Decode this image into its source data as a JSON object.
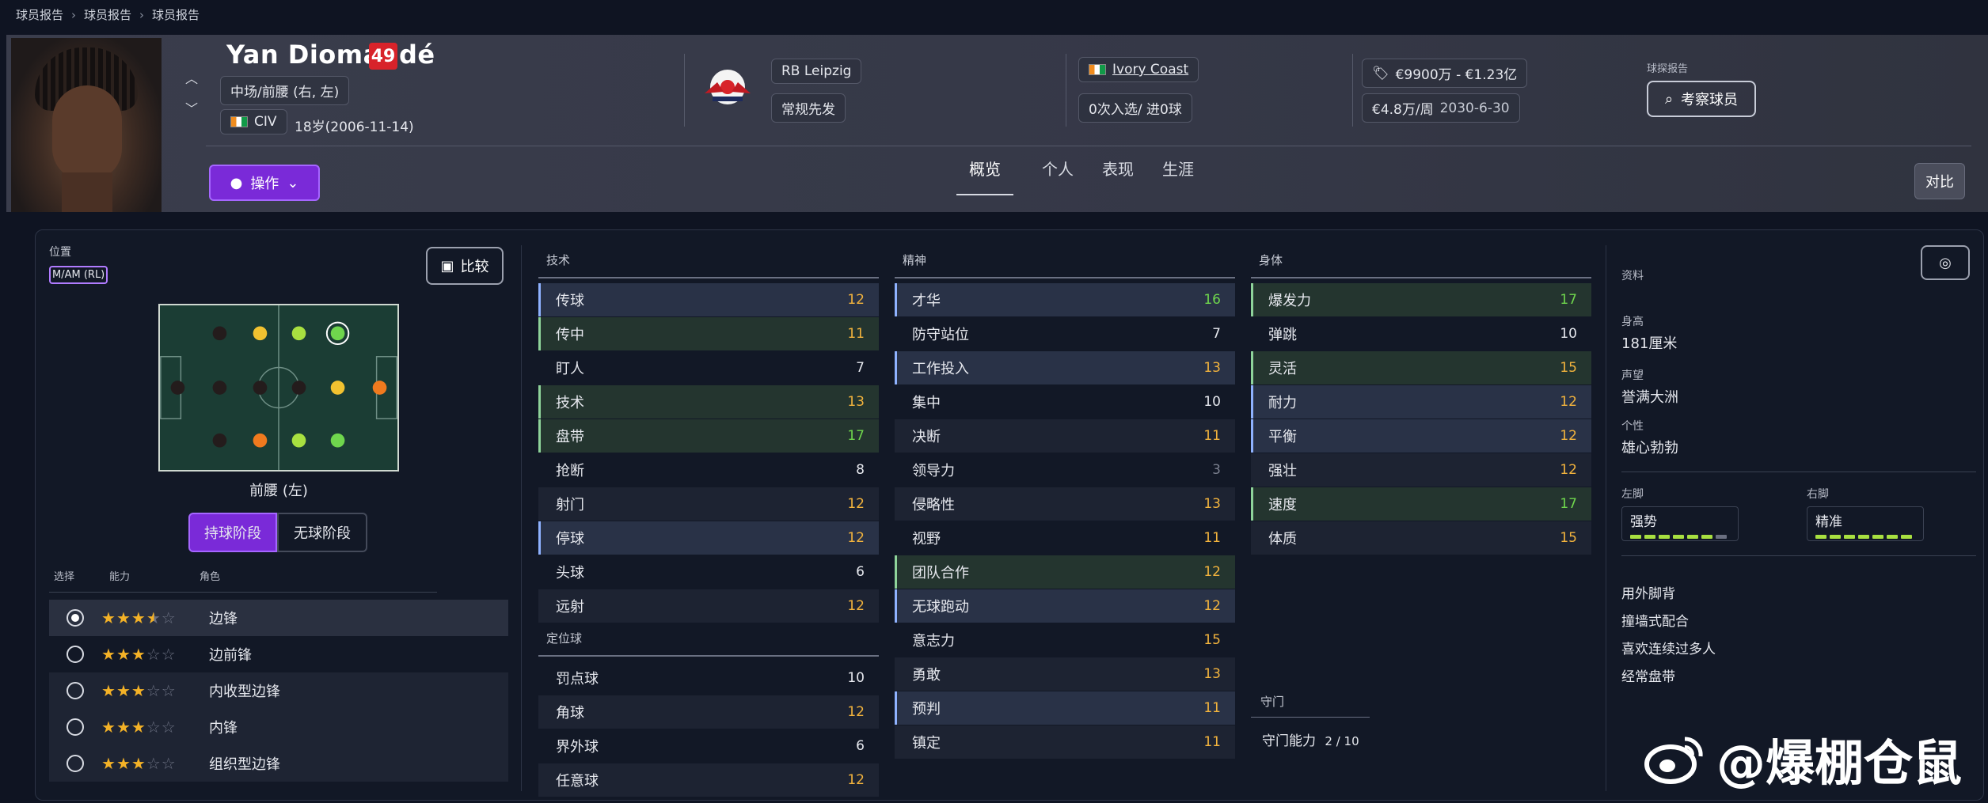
{
  "breadcrumb": [
    "球员报告",
    "球员报告",
    "球员报告"
  ],
  "header": {
    "name": "Yan Diomandé",
    "ca": "49",
    "position": "中场/前腰 (右, 左)",
    "nation_code": "CIV",
    "age_dob": "18岁(2006-11-14)",
    "club": "RB Leipzig",
    "squad_status": "常规先发",
    "nationality": "Ivory Coast",
    "caps": "0次入选/ 进0球",
    "value": "€9900万 - €1.23亿",
    "wage": "€4.8万/周",
    "contract": "2030-6-30",
    "scout_label": "球探报告",
    "scout_button": "考察球员",
    "actions_button": "操作",
    "compare_button": "对比",
    "tabs": [
      "概览",
      "个人",
      "表现",
      "生涯"
    ],
    "active_tab": "概览"
  },
  "position_panel": {
    "label": "位置",
    "tag": "M/AM (RL)",
    "compare_button": "比较",
    "pitch_caption": "前腰 (左)",
    "phases": [
      "持球阶段",
      "无球阶段"
    ],
    "active_phase": "持球阶段",
    "role_headers": [
      "选择",
      "能力",
      "角色"
    ],
    "roles": [
      {
        "name": "边锋",
        "stars": 3.5,
        "selected": true
      },
      {
        "name": "边前锋",
        "stars": 3,
        "selected": false
      },
      {
        "name": "内收型边锋",
        "stars": 3,
        "selected": false
      },
      {
        "name": "内锋",
        "stars": 3,
        "selected": false
      },
      {
        "name": "组织型边锋",
        "stars": 3,
        "selected": false
      }
    ],
    "pitch_colors": {
      "good": "#6fd64d",
      "ok": "#a8e040",
      "fair": "#f2c230",
      "weak": "#f07a1e",
      "none": "#241c1c"
    }
  },
  "technical": {
    "title": "技术",
    "attrs": [
      {
        "name": "传球",
        "value": "12",
        "color": "yellow",
        "hl": "b"
      },
      {
        "name": "传中",
        "value": "11",
        "color": "yellow",
        "hl": "g"
      },
      {
        "name": "盯人",
        "value": "7",
        "color": "white",
        "hl": ""
      },
      {
        "name": "技术",
        "value": "13",
        "color": "yellow",
        "hl": "g"
      },
      {
        "name": "盘带",
        "value": "17",
        "color": "green",
        "hl": "g"
      },
      {
        "name": "抢断",
        "value": "8",
        "color": "white",
        "hl": ""
      },
      {
        "name": "射门",
        "value": "12",
        "color": "yellow",
        "hl": "shade"
      },
      {
        "name": "停球",
        "value": "12",
        "color": "yellow",
        "hl": "b"
      },
      {
        "name": "头球",
        "value": "6",
        "color": "white",
        "hl": ""
      },
      {
        "name": "远射",
        "value": "12",
        "color": "yellow",
        "hl": "shade"
      }
    ]
  },
  "set_pieces": {
    "title": "定位球",
    "attrs": [
      {
        "name": "罚点球",
        "value": "10",
        "color": "white",
        "hl": ""
      },
      {
        "name": "角球",
        "value": "12",
        "color": "yellow",
        "hl": "shade"
      },
      {
        "name": "界外球",
        "value": "6",
        "color": "white",
        "hl": ""
      },
      {
        "name": "任意球",
        "value": "12",
        "color": "yellow",
        "hl": "shade"
      }
    ]
  },
  "mental": {
    "title": "精神",
    "attrs": [
      {
        "name": "才华",
        "value": "16",
        "color": "green",
        "hl": "b"
      },
      {
        "name": "防守站位",
        "value": "7",
        "color": "white",
        "hl": ""
      },
      {
        "name": "工作投入",
        "value": "13",
        "color": "yellow",
        "hl": "b"
      },
      {
        "name": "集中",
        "value": "10",
        "color": "white",
        "hl": ""
      },
      {
        "name": "决断",
        "value": "11",
        "color": "yellow",
        "hl": "shade"
      },
      {
        "name": "领导力",
        "value": "3",
        "color": "gray",
        "hl": ""
      },
      {
        "name": "侵略性",
        "value": "13",
        "color": "yellow",
        "hl": "shade"
      },
      {
        "name": "视野",
        "value": "11",
        "color": "yellow",
        "hl": ""
      },
      {
        "name": "团队合作",
        "value": "12",
        "color": "yellow",
        "hl": "g"
      },
      {
        "name": "无球跑动",
        "value": "12",
        "color": "yellow",
        "hl": "b"
      },
      {
        "name": "意志力",
        "value": "15",
        "color": "yellow",
        "hl": ""
      },
      {
        "name": "勇敢",
        "value": "13",
        "color": "yellow",
        "hl": "shade"
      },
      {
        "name": "预判",
        "value": "11",
        "color": "yellow",
        "hl": "b"
      },
      {
        "name": "镇定",
        "value": "11",
        "color": "yellow",
        "hl": "shade"
      }
    ]
  },
  "physical": {
    "title": "身体",
    "attrs": [
      {
        "name": "爆发力",
        "value": "17",
        "color": "green",
        "hl": "g"
      },
      {
        "name": "弹跳",
        "value": "10",
        "color": "white",
        "hl": ""
      },
      {
        "name": "灵活",
        "value": "15",
        "color": "yellow",
        "hl": "g"
      },
      {
        "name": "耐力",
        "value": "12",
        "color": "yellow",
        "hl": "b"
      },
      {
        "name": "平衡",
        "value": "12",
        "color": "yellow",
        "hl": "b"
      },
      {
        "name": "强壮",
        "value": "12",
        "color": "yellow",
        "hl": "shade"
      },
      {
        "name": "速度",
        "value": "17",
        "color": "green",
        "hl": "g"
      },
      {
        "name": "体质",
        "value": "15",
        "color": "yellow",
        "hl": "shade"
      }
    ]
  },
  "goalkeeping": {
    "title": "守门",
    "label": "守门能力",
    "value": "2 / 10"
  },
  "info": {
    "title": "资料",
    "height_label": "身高",
    "height": "181厘米",
    "reputation_label": "声望",
    "reputation": "誉满大洲",
    "personality_label": "个性",
    "personality": "雄心勃勃",
    "left_foot_label": "左脚",
    "left_foot": "强势",
    "left_foot_level": 6,
    "right_foot_label": "右脚",
    "right_foot": "精准",
    "right_foot_level": 7,
    "traits": [
      "用外脚背",
      "撞墙式配合",
      "喜欢连续过多人",
      "经常盘带"
    ]
  },
  "watermark": "@爆棚仓鼠"
}
